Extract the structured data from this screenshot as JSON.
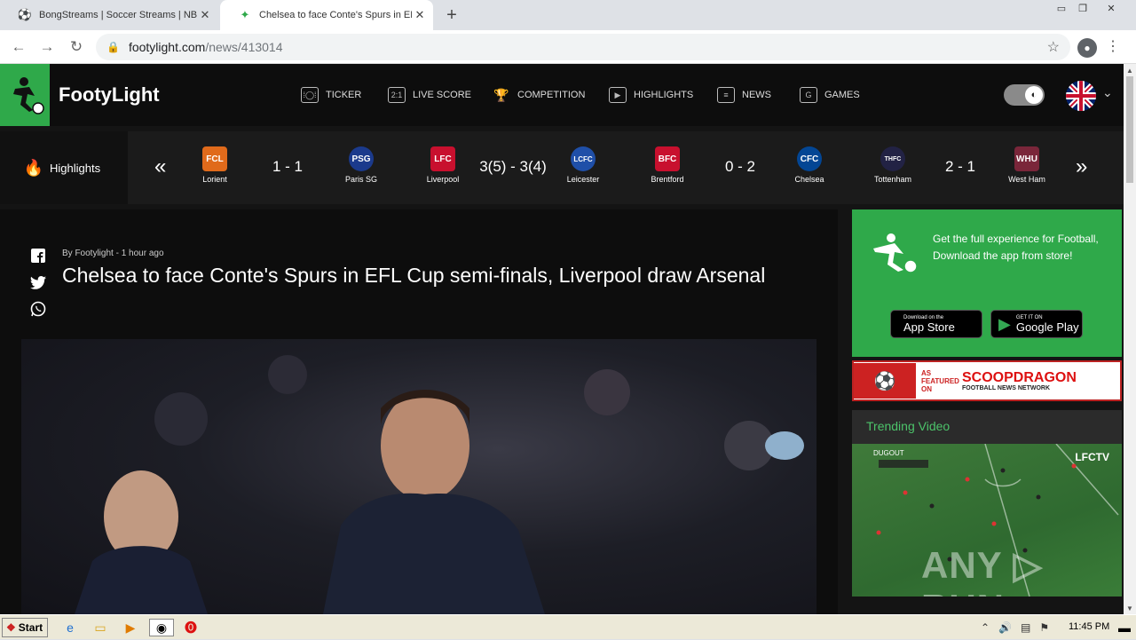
{
  "browser": {
    "tabs": [
      {
        "title": "BongStreams | Soccer Streams | NBA",
        "favicon": "soccer-player-icon",
        "active": false
      },
      {
        "title": "Chelsea to face Conte's Spurs in EFL",
        "favicon": "footylight-icon",
        "active": true
      }
    ],
    "url_host": "footylight.com",
    "url_path": "/news/413014"
  },
  "site": {
    "brand": "FootyLight",
    "nav": [
      {
        "label": "TICKER",
        "icon": "ticker-icon",
        "glyph": "⁞◯⁞"
      },
      {
        "label": "LIVE SCORE",
        "icon": "livescore-icon",
        "glyph": "2:1"
      },
      {
        "label": "COMPETITION",
        "icon": "trophy-icon",
        "glyph": "🏆"
      },
      {
        "label": "HIGHLIGHTS",
        "icon": "play-icon",
        "glyph": "▶"
      },
      {
        "label": "NEWS",
        "icon": "news-icon",
        "glyph": "≡"
      },
      {
        "label": "GAMES",
        "icon": "games-icon",
        "glyph": "G"
      }
    ]
  },
  "highlights": {
    "label": "Highlights",
    "matches": [
      {
        "home": "Lorient",
        "away": "Paris SG",
        "score": "1 - 1",
        "home_color": "#e06a1b",
        "away_color": "#1b3a8c",
        "home_abbr": "FCL",
        "away_abbr": "PSG"
      },
      {
        "home": "Liverpool",
        "away": "Leicester",
        "score": "3(5) - 3(4)",
        "home_color": "#c8102e",
        "away_color": "#1f4fa8",
        "home_abbr": "LFC",
        "away_abbr": "LCFC"
      },
      {
        "home": "Brentford",
        "away": "Chelsea",
        "score": "0 - 2",
        "home_color": "#c8102e",
        "away_color": "#034694",
        "home_abbr": "BFC",
        "away_abbr": "CFC"
      },
      {
        "home": "Tottenham",
        "away": "West Ham",
        "score": "2 - 1",
        "home_color": "#222244",
        "away_color": "#7a263a",
        "home_abbr": "THFC",
        "away_abbr": "WHU"
      }
    ]
  },
  "article": {
    "byline": "By Footylight - 1 hour ago",
    "headline": "Chelsea to face Conte's Spurs in EFL Cup semi-finals, Liverpool draw Arsenal"
  },
  "sidebar": {
    "promo_text": "Get the full experience for Football, Download the app from store!",
    "app_store": {
      "small": "Download on the",
      "big": "App Store"
    },
    "google_play": {
      "small": "GET IT ON",
      "big": "Google Play"
    },
    "banner": {
      "featured": "AS FEATURED ON",
      "name": "SCOOPDRAGON",
      "network": "FOOTBALL NEWS NETWORK"
    },
    "trending_title": "Trending Video",
    "video": {
      "channel": "DUGOUT",
      "brand": "LFCTV",
      "watermark": "ANY ▷ RUN"
    }
  },
  "taskbar": {
    "start": "Start",
    "clock": "11:45 PM"
  },
  "colors": {
    "brand_green": "#2fa94a",
    "dark_bg": "#141414"
  }
}
